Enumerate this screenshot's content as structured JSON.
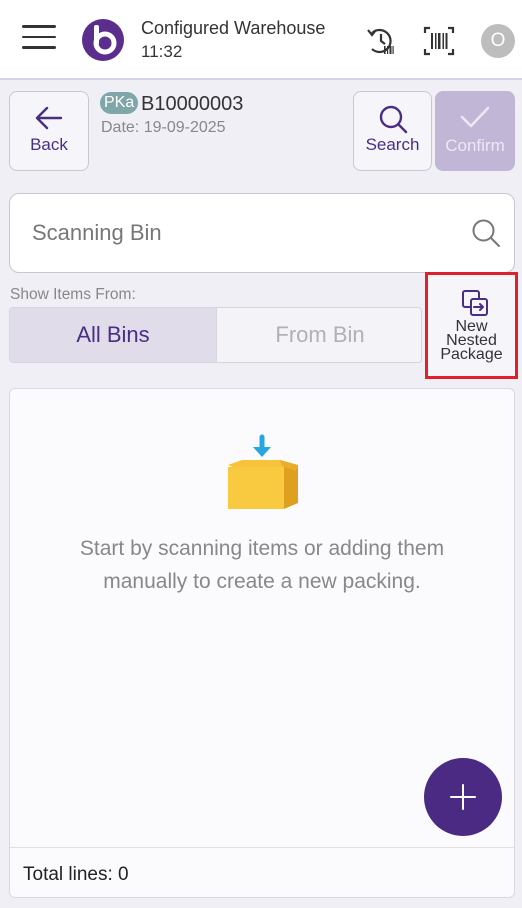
{
  "header": {
    "title": "Configured Warehouse",
    "time": "11:32",
    "avatar_initial": "O"
  },
  "document": {
    "badge": "PKa",
    "number": "B10000003",
    "date": "Date: 19-09-2025"
  },
  "actions": {
    "back_label": "Back",
    "search_label": "Search",
    "confirm_label": "Confirm"
  },
  "scan": {
    "placeholder": "Scanning Bin"
  },
  "filter": {
    "label": "Show Items From:",
    "options": [
      "All Bins",
      "From Bin"
    ],
    "selected": "All Bins"
  },
  "nested_package": {
    "line1": "New",
    "line2": "Nested",
    "line3": "Package"
  },
  "content": {
    "empty_line1": "Start by scanning items or adding them",
    "empty_line2": "manually to create a new packing.",
    "total_lines": "Total lines: 0"
  },
  "colors": {
    "brand": "#4a2a82",
    "highlight": "#e0212a",
    "confirm_disabled": "#c1b6d6"
  }
}
